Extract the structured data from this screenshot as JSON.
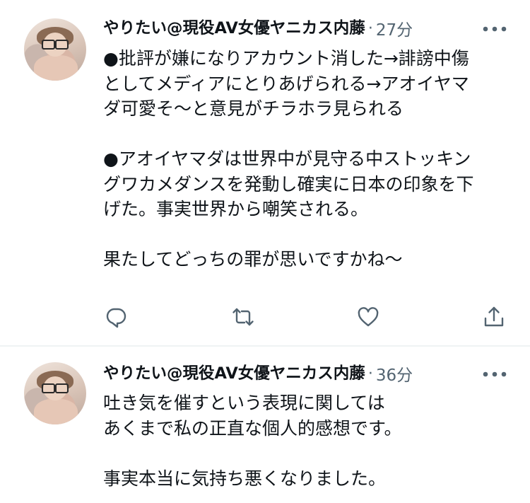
{
  "colors": {
    "text": "#0f1419",
    "secondary": "#536471",
    "divider": "#eff3f4",
    "background": "#ffffff"
  },
  "tweets": [
    {
      "author_name": "やりたい@現役AV女優ヤニカス内藤",
      "separator": "·",
      "time": "27分",
      "more_icon": "more-horizontal-icon",
      "avatar": "profile-photo",
      "lines": [
        "●批評が嫌になりアカウント消した→誹謗中傷",
        "としてメディアにとりあげられる→アオイヤマ",
        "ダ可愛そ〜と意見がチラホラ見られる",
        "",
        "●アオイヤマダは世界中が見守る中ストッキン",
        "グワカメダンスを発動し確実に日本の印象を下",
        "げた。事実世界から嘲笑される。",
        "",
        "果たしてどっちの罪が思いですかね〜"
      ],
      "actions": {
        "reply_icon": "reply-icon",
        "retweet_icon": "retweet-icon",
        "like_icon": "like-heart-icon",
        "share_icon": "share-icon"
      }
    },
    {
      "author_name": "やりたい@現役AV女優ヤニカス内藤",
      "separator": "·",
      "time": "36分",
      "more_icon": "more-horizontal-icon",
      "avatar": "profile-photo",
      "lines": [
        "吐き気を催すという表現に関しては",
        "あくまで私の正直な個人的感想です。",
        "",
        "事実本当に気持ち悪くなりました。"
      ]
    }
  ]
}
